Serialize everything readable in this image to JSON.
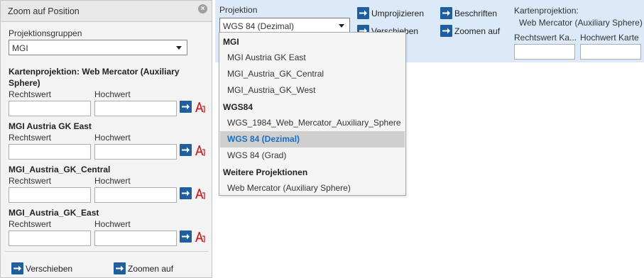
{
  "panel": {
    "title": "Zoom auf Position",
    "close_icon": "close-circle-icon",
    "groups_label": "Projektionsgruppen",
    "groups_value": "MGI",
    "sections": [
      {
        "title_line1": "Kartenprojektion: Web Mercator (Auxiliary",
        "title_line2": "Sphere)",
        "rechts_label": "Rechtswert",
        "hoch_label": "Hochwert"
      },
      {
        "title": "MGI Austria GK East",
        "rechts_label": "Rechtswert",
        "hoch_label": "Hochwert"
      },
      {
        "title": "MGI_Austria_GK_Central",
        "rechts_label": "Rechtswert",
        "hoch_label": "Hochwert"
      },
      {
        "title": "MGI_Austria_GK_East",
        "rechts_label": "Rechtswert",
        "hoch_label": "Hochwert"
      }
    ],
    "footer": {
      "move_label": "Verschieben",
      "zoom_label": "Zoomen auf"
    }
  },
  "ribbon": {
    "projection_label": "Projektion",
    "projection_value": "WGS 84 (Dezimal)",
    "reproject_label": "Umprojizieren",
    "move_label": "Verschieben",
    "label_label": "Beschriften",
    "zoom_label": "Zoomen auf",
    "map_projection_label": "Kartenprojektion:",
    "map_projection_value": "Web Mercator (Auxiliary Sphere)",
    "rechts_label": "Rechtswert Ka...",
    "hoch_label": "Hochwert Karte"
  },
  "dropdown": {
    "group_mgi": "MGI",
    "mgi_items": [
      "MGI Austria GK East",
      "MGI_Austria_GK_Central",
      "MGI_Austria_GK_West"
    ],
    "group_wgs84": "WGS84",
    "wgs84_items": [
      "WGS_1984_Web_Mercator_Auxiliary_Sphere",
      "WGS 84 (Dezimal)",
      "WGS 84 (Grad)"
    ],
    "selected": "WGS 84 (Dezimal)",
    "group_more": "Weitere Projektionen",
    "more_items": [
      "Web Mercator (Auxiliary Sphere)"
    ]
  },
  "colors": {
    "button_blue": "#1f5f9f",
    "ribbon_bg": "#dce9f9",
    "selected_text": "#1a6fc4"
  }
}
